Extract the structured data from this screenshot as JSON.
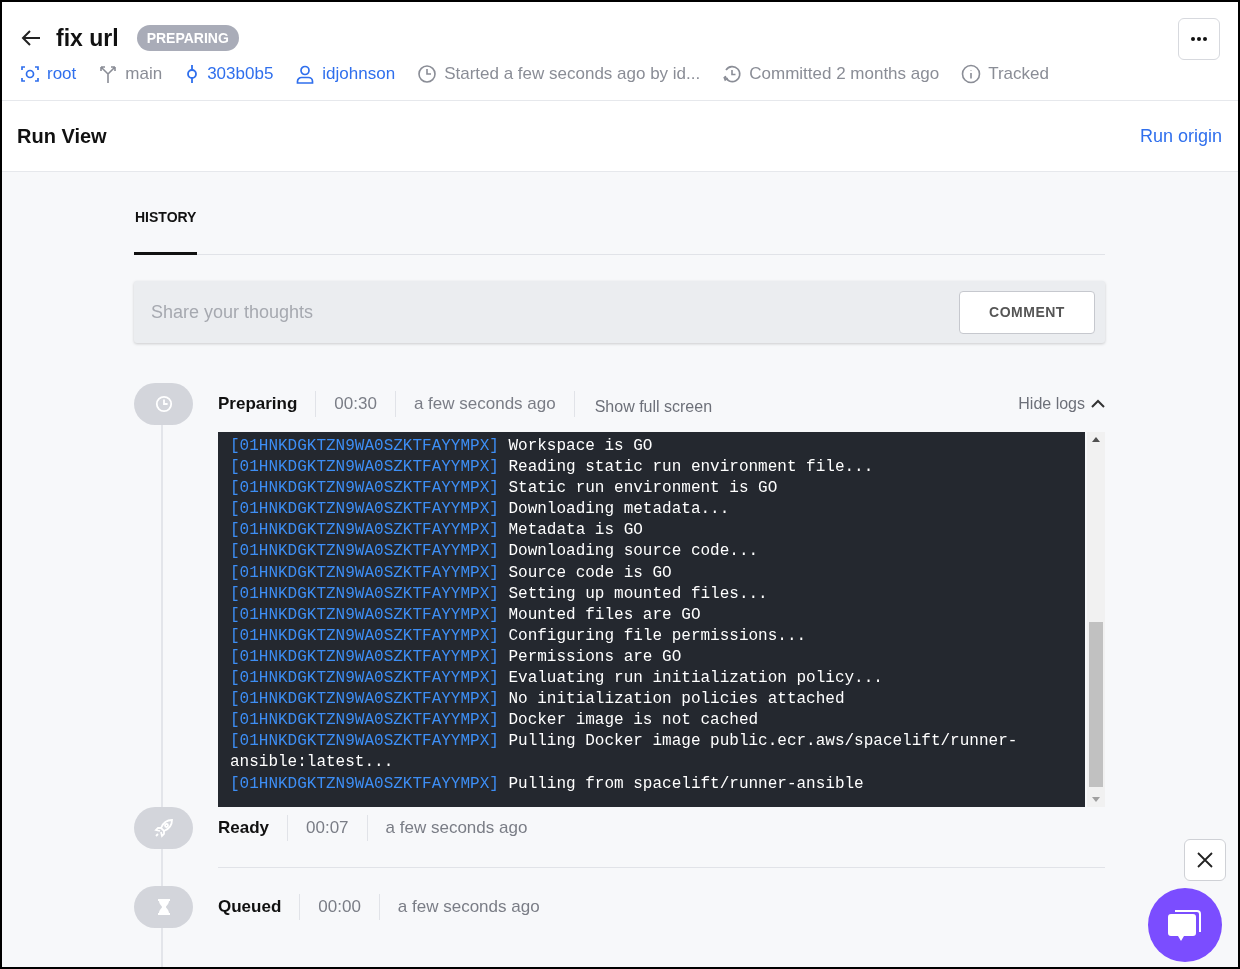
{
  "header": {
    "title": "fix url",
    "status_badge": "PREPARING",
    "meta": [
      {
        "kind": "space",
        "text": "root",
        "link": true
      },
      {
        "kind": "branch",
        "text": "main",
        "link": false
      },
      {
        "kind": "commit",
        "text": "303b0b5",
        "link": true
      },
      {
        "kind": "user",
        "text": "idjohnson",
        "link": true
      },
      {
        "kind": "clock",
        "text": "Started a few seconds ago by id...",
        "link": false
      },
      {
        "kind": "history",
        "text": "Committed 2 months ago",
        "link": false
      },
      {
        "kind": "info",
        "text": "Tracked",
        "link": false
      }
    ]
  },
  "subheader": {
    "title": "Run View",
    "link": "Run origin"
  },
  "tabs": [
    {
      "label": "HISTORY",
      "selected": true
    }
  ],
  "comment": {
    "placeholder": "Share your thoughts",
    "button": "COMMENT"
  },
  "stages": [
    {
      "kind": "clock",
      "name": "Preparing",
      "duration": "00:30",
      "time": "a few seconds ago",
      "full_screen": "Show full screen",
      "logs_toggle": "Hide logs",
      "expanded": true,
      "logs": [
        {
          "id": "[01HNKDGKTZN9WA0SZKTFAYYMPX]",
          "message": "Workspace is GO"
        },
        {
          "id": "[01HNKDGKTZN9WA0SZKTFAYYMPX]",
          "message": "Reading static run environment file..."
        },
        {
          "id": "[01HNKDGKTZN9WA0SZKTFAYYMPX]",
          "message": "Static run environment is GO"
        },
        {
          "id": "[01HNKDGKTZN9WA0SZKTFAYYMPX]",
          "message": "Downloading metadata..."
        },
        {
          "id": "[01HNKDGKTZN9WA0SZKTFAYYMPX]",
          "message": "Metadata is GO"
        },
        {
          "id": "[01HNKDGKTZN9WA0SZKTFAYYMPX]",
          "message": "Downloading source code..."
        },
        {
          "id": "[01HNKDGKTZN9WA0SZKTFAYYMPX]",
          "message": "Source code is GO"
        },
        {
          "id": "[01HNKDGKTZN9WA0SZKTFAYYMPX]",
          "message": "Setting up mounted files..."
        },
        {
          "id": "[01HNKDGKTZN9WA0SZKTFAYYMPX]",
          "message": "Mounted files are GO"
        },
        {
          "id": "[01HNKDGKTZN9WA0SZKTFAYYMPX]",
          "message": "Configuring file permissions..."
        },
        {
          "id": "[01HNKDGKTZN9WA0SZKTFAYYMPX]",
          "message": "Permissions are GO"
        },
        {
          "id": "[01HNKDGKTZN9WA0SZKTFAYYMPX]",
          "message": "Evaluating run initialization policy..."
        },
        {
          "id": "[01HNKDGKTZN9WA0SZKTFAYYMPX]",
          "message": "No initialization policies attached"
        },
        {
          "id": "[01HNKDGKTZN9WA0SZKTFAYYMPX]",
          "message": "Docker image is not cached"
        },
        {
          "id": "[01HNKDGKTZN9WA0SZKTFAYYMPX]",
          "message": "Pulling Docker image public.ecr.aws/spacelift/runner-ansible:latest..."
        },
        {
          "id": "[01HNKDGKTZN9WA0SZKTFAYYMPX]",
          "message": "Pulling from spacelift/runner-ansible"
        }
      ]
    },
    {
      "kind": "rocket",
      "name": "Ready",
      "duration": "00:07",
      "time": "a few seconds ago"
    },
    {
      "kind": "hourglass",
      "name": "Queued",
      "duration": "00:00",
      "time": "a few seconds ago"
    }
  ]
}
